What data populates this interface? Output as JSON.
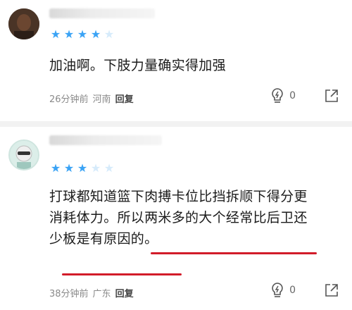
{
  "comments": [
    {
      "stars_filled": 4,
      "stars_total": 5,
      "text": "加油啊。下肢力量确实得加强",
      "time": "26分钟前",
      "location": "河南",
      "reply_label": "回复",
      "like_count": "0"
    },
    {
      "stars_filled": 3,
      "stars_total": 5,
      "text_line1": "打球都知道篮下肉搏卡位比挡拆顺下得分更",
      "text_line2": "消耗体力。所以两米多的大个经常比后卫还",
      "text_line3": "少板是有原因的。",
      "time": "38分钟前",
      "location": "广东",
      "reply_label": "回复",
      "like_count": "0"
    }
  ],
  "colors": {
    "star_on": "#3aa3f5",
    "star_off": "#d6ebfb",
    "underline": "#d21c2a"
  }
}
